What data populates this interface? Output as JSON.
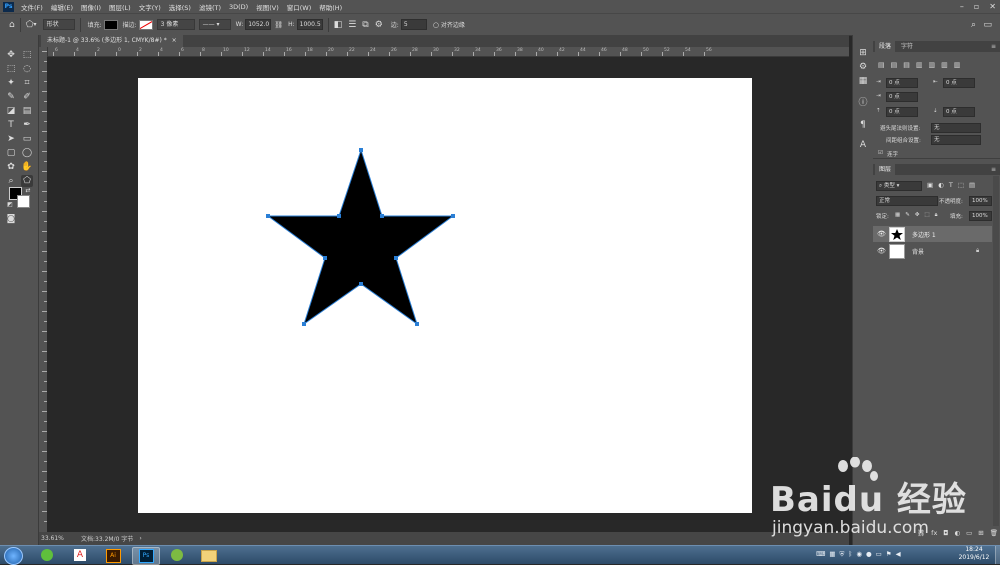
{
  "menu": {
    "items": [
      "文件(F)",
      "编辑(E)",
      "图像(I)",
      "图层(L)",
      "文字(Y)",
      "选择(S)",
      "滤镜(T)",
      "3D(D)",
      "视图(V)",
      "窗口(W)",
      "帮助(H)"
    ]
  },
  "options": {
    "mode": "形状",
    "fill_label": "填充:",
    "stroke_label": "描边:",
    "stroke_width": "3 像素",
    "w_label": "W:",
    "w_value": "1052.0",
    "h_label": "H:",
    "h_value": "1000.5",
    "sides_label": "边:",
    "sides_value": "5",
    "align_edges": "对齐边缘"
  },
  "document": {
    "tab_title": "未标题-1 @ 33.6% (多边形 1, CMYK/8#) *",
    "close": "×"
  },
  "ruler": {
    "h_ticks": [
      "6",
      "4",
      "2",
      "0",
      "2",
      "4",
      "6",
      "8",
      "10",
      "12",
      "14",
      "16",
      "18",
      "20",
      "22",
      "24",
      "26",
      "28",
      "30",
      "32",
      "34",
      "36",
      "38",
      "40",
      "42",
      "44",
      "46",
      "48",
      "50",
      "52",
      "54",
      "56"
    ]
  },
  "status": {
    "zoom": "33.61%",
    "doc_info": "文档:33.2M/0 字节"
  },
  "panels": {
    "paragraph_tab": "段落",
    "character_tab": "字符",
    "fields": [
      "0 点",
      "0 点",
      "0 点",
      "0 点",
      "0 点"
    ],
    "kinsoku_label": "避头尾法则设置:",
    "kinsoku_value": "无",
    "mojikumi_label": "间距组合设置:",
    "mojikumi_value": "无",
    "hyphenate": "连字",
    "layers_tab": "图层",
    "filter_kind": "类型",
    "blend_mode": "正常",
    "opacity_label": "不透明度:",
    "opacity_value": "100%",
    "lock_label": "锁定:",
    "fill_label": "填充:",
    "fill_value": "100%",
    "layers": [
      {
        "name": "多边形 1",
        "selected": true
      },
      {
        "name": "背景",
        "selected": false
      }
    ]
  },
  "taskbar": {
    "time": "18:24",
    "date": "2019/6/12"
  },
  "watermark": {
    "brand": "Baidu 经验",
    "url": "jingyan.baidu.com"
  },
  "colors": {
    "ui_panel": "#535353",
    "workspace": "#282828",
    "path_anchor": "#2a7fd6",
    "star_fill": "#000000"
  },
  "icons": [
    "home-icon",
    "polygon-tool-icon",
    "move-tool-icon",
    "marquee-tool-icon",
    "lasso-tool-icon",
    "crop-tool-icon",
    "brush-tool-icon",
    "type-tool-icon",
    "hand-tool-icon",
    "zoom-tool-icon",
    "eye-icon",
    "lock-icon",
    "start-orb-icon",
    "photoshop-icon",
    "illustrator-icon",
    "acrobat-icon"
  ]
}
